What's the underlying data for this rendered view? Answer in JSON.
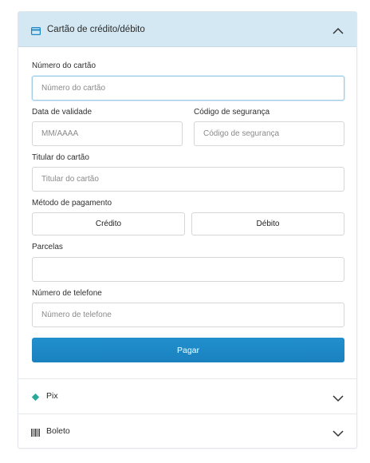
{
  "card_section": {
    "title": "Cartão de crédito/débito",
    "card_number": {
      "label": "Número do cartão",
      "placeholder": "Número do cartão",
      "value": ""
    },
    "expiry": {
      "label": "Data de validade",
      "placeholder": "MM/AAAA",
      "value": ""
    },
    "security_code": {
      "label": "Código de segurança",
      "placeholder": "Código de segurança",
      "value": ""
    },
    "holder": {
      "label": "Titular do cartão",
      "placeholder": "Titular do cartão",
      "value": ""
    },
    "payment_method": {
      "label": "Método de pagamento",
      "options": [
        "Crédito",
        "Débito"
      ]
    },
    "installments": {
      "label": "Parcelas",
      "value": ""
    },
    "phone": {
      "label": "Número de telefone",
      "placeholder": "Número de telefone",
      "value": ""
    },
    "pay_button": "Pagar"
  },
  "other_methods": [
    {
      "label": "Pix",
      "icon": "pix-icon"
    },
    {
      "label": "Boleto",
      "icon": "barcode-icon"
    }
  ],
  "colors": {
    "header_bg": "#d3e8f2",
    "accent": "#1a86c6",
    "pix": "#2aa89a"
  }
}
